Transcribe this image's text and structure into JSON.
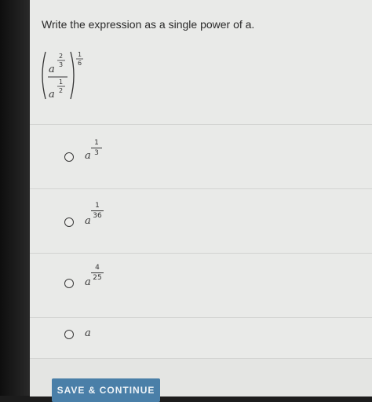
{
  "question": {
    "prompt": "Write the expression as a single power of a.",
    "expression": {
      "base": "a",
      "numerator_exp": {
        "num": "2",
        "den": "3"
      },
      "denominator_exp": {
        "num": "1",
        "den": "2"
      },
      "outer_exp": {
        "num": "1",
        "den": "6"
      }
    }
  },
  "options": [
    {
      "base": "a",
      "exp_num": "1",
      "exp_den": "3"
    },
    {
      "base": "a",
      "exp_num": "1",
      "exp_den": "36"
    },
    {
      "base": "a",
      "exp_num": "4",
      "exp_den": "25"
    },
    {
      "base": "a",
      "exp_num": "",
      "exp_den": ""
    }
  ],
  "footer": {
    "save_label": "SAVE & CONTINUE"
  }
}
